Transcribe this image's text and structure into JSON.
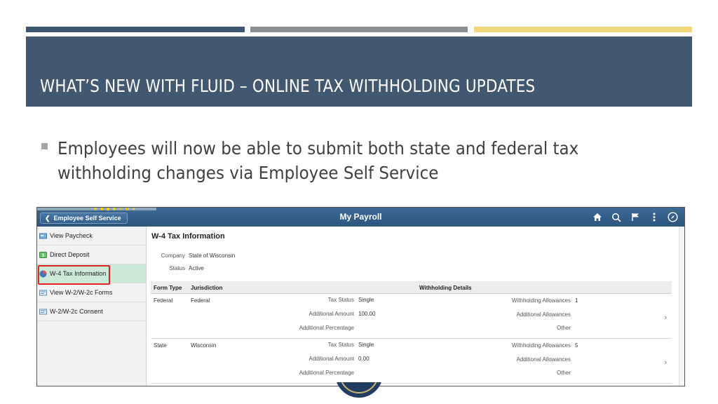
{
  "slide": {
    "title": "WHAT’S NEW WITH FLUID – ONLINE TAX WITHHOLDING UPDATES",
    "bullet": "Employees will now be able to submit both state and federal tax withholding changes via Employee Self Service"
  },
  "app": {
    "back_label": "Employee Self Service",
    "title": "My Payroll",
    "header_icons": [
      "home-icon",
      "search-icon",
      "flag-icon",
      "more-vertical-icon",
      "compass-icon"
    ]
  },
  "sidebar": {
    "items": [
      {
        "label": "View Paycheck",
        "icon": "paycheck-icon",
        "selected": false
      },
      {
        "label": "Direct Deposit",
        "icon": "deposit-icon",
        "selected": false
      },
      {
        "label": "W-4 Tax Information",
        "icon": "pie-chart-icon",
        "selected": true
      },
      {
        "label": "View W-2/W-2c Forms",
        "icon": "form-icon",
        "selected": false
      },
      {
        "label": "W-2/W-2c Consent",
        "icon": "form-icon",
        "selected": false
      }
    ]
  },
  "main": {
    "title": "W-4 Tax Information",
    "company_label": "Company",
    "company_value": "State of Wisconsin",
    "status_label": "Status",
    "status_value": "Active",
    "columns": {
      "form_type": "Form Type",
      "jurisdiction": "Jurisdiction",
      "details": "Withholding Details"
    },
    "rows": [
      {
        "form_type": "Federal",
        "jurisdiction": "Federal",
        "tax_status_label": "Tax Status",
        "tax_status": "Single",
        "additional_amount_label": "Additional Amount",
        "additional_amount": "100.00",
        "additional_percentage_label": "Additional Percentage",
        "additional_percentage": "",
        "allowances_label": "Withholding Allowances",
        "allowances": "1",
        "additional_allowances_label": "Additional Allowances",
        "additional_allowances": "",
        "other_label": "Other",
        "other": ""
      },
      {
        "form_type": "State",
        "jurisdiction": "Wisconsin",
        "tax_status_label": "Tax Status",
        "tax_status": "Single",
        "additional_amount_label": "Additional Amount",
        "additional_amount": "0.00",
        "additional_percentage_label": "Additional Percentage",
        "additional_percentage": "",
        "allowances_label": "Withholding Allowances",
        "allowances": "5",
        "additional_allowances_label": "Additional Allowances",
        "additional_allowances": "",
        "other_label": "Other",
        "other": ""
      }
    ]
  },
  "colors": {
    "header_band": "#425770",
    "bar_dark": "#3d5570",
    "bar_gray": "#8a9096",
    "bar_yellow": "#f0d77c",
    "app_bar": "#2b557e",
    "selected_item": "#cde9d8",
    "highlight_border": "#e02424"
  }
}
